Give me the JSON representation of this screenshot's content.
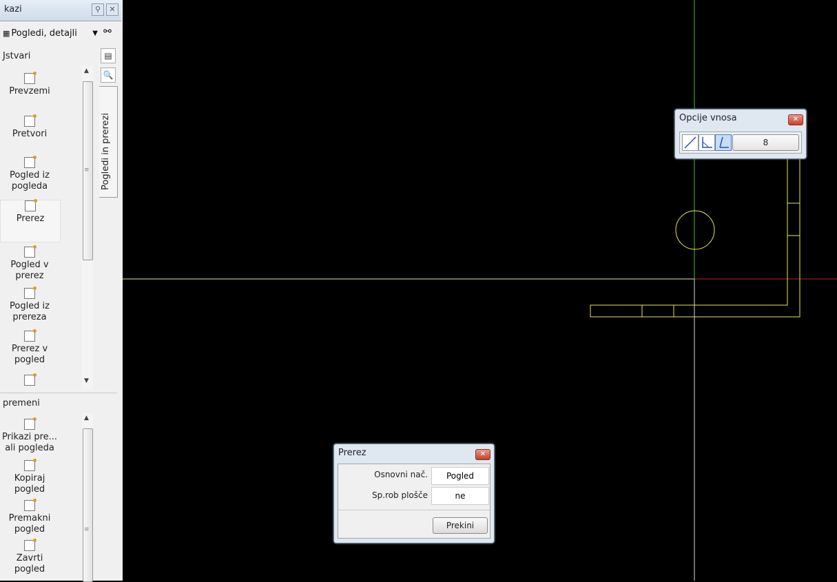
{
  "panel": {
    "title": "kazi",
    "view_dropdown": {
      "value": "Pogledi, detajli"
    },
    "vertical_tab": "Pogledi in prerezi",
    "group1": {
      "title": "Jstvari",
      "items": [
        {
          "label": "Prevzemi"
        },
        {
          "label": "Pretvori"
        },
        {
          "label": "Pogled iz pogleda"
        },
        {
          "label": "Prerez"
        },
        {
          "label": "Pogled v prerez"
        },
        {
          "label": "Pogled iz prereza"
        },
        {
          "label": "Prerez v pogled"
        }
      ]
    },
    "group2": {
      "title": "premeni",
      "items": [
        {
          "label": "Prikazi pre... ali pogleda"
        },
        {
          "label": "Kopiraj pogled"
        },
        {
          "label": "Premakni pogled"
        },
        {
          "label": "Zavrti pogled"
        }
      ]
    }
  },
  "input_options": {
    "title": "Opcije vnosa",
    "value": "8",
    "icons": [
      "line-icon",
      "angle-icon",
      "tangent-icon"
    ]
  },
  "section_dialog": {
    "title": "Prerez",
    "fields": [
      {
        "label": "Osnovni nač.",
        "value": "Pogled"
      },
      {
        "label": "Sp.rob plošče",
        "value": "ne"
      }
    ],
    "cancel_label": "Prekini"
  },
  "colors": {
    "canvas": "#000000",
    "geometry": "#e8e850",
    "axis_x": "#e8e8a0",
    "axis_y": "#40c040",
    "axis_red": "#c02020"
  }
}
